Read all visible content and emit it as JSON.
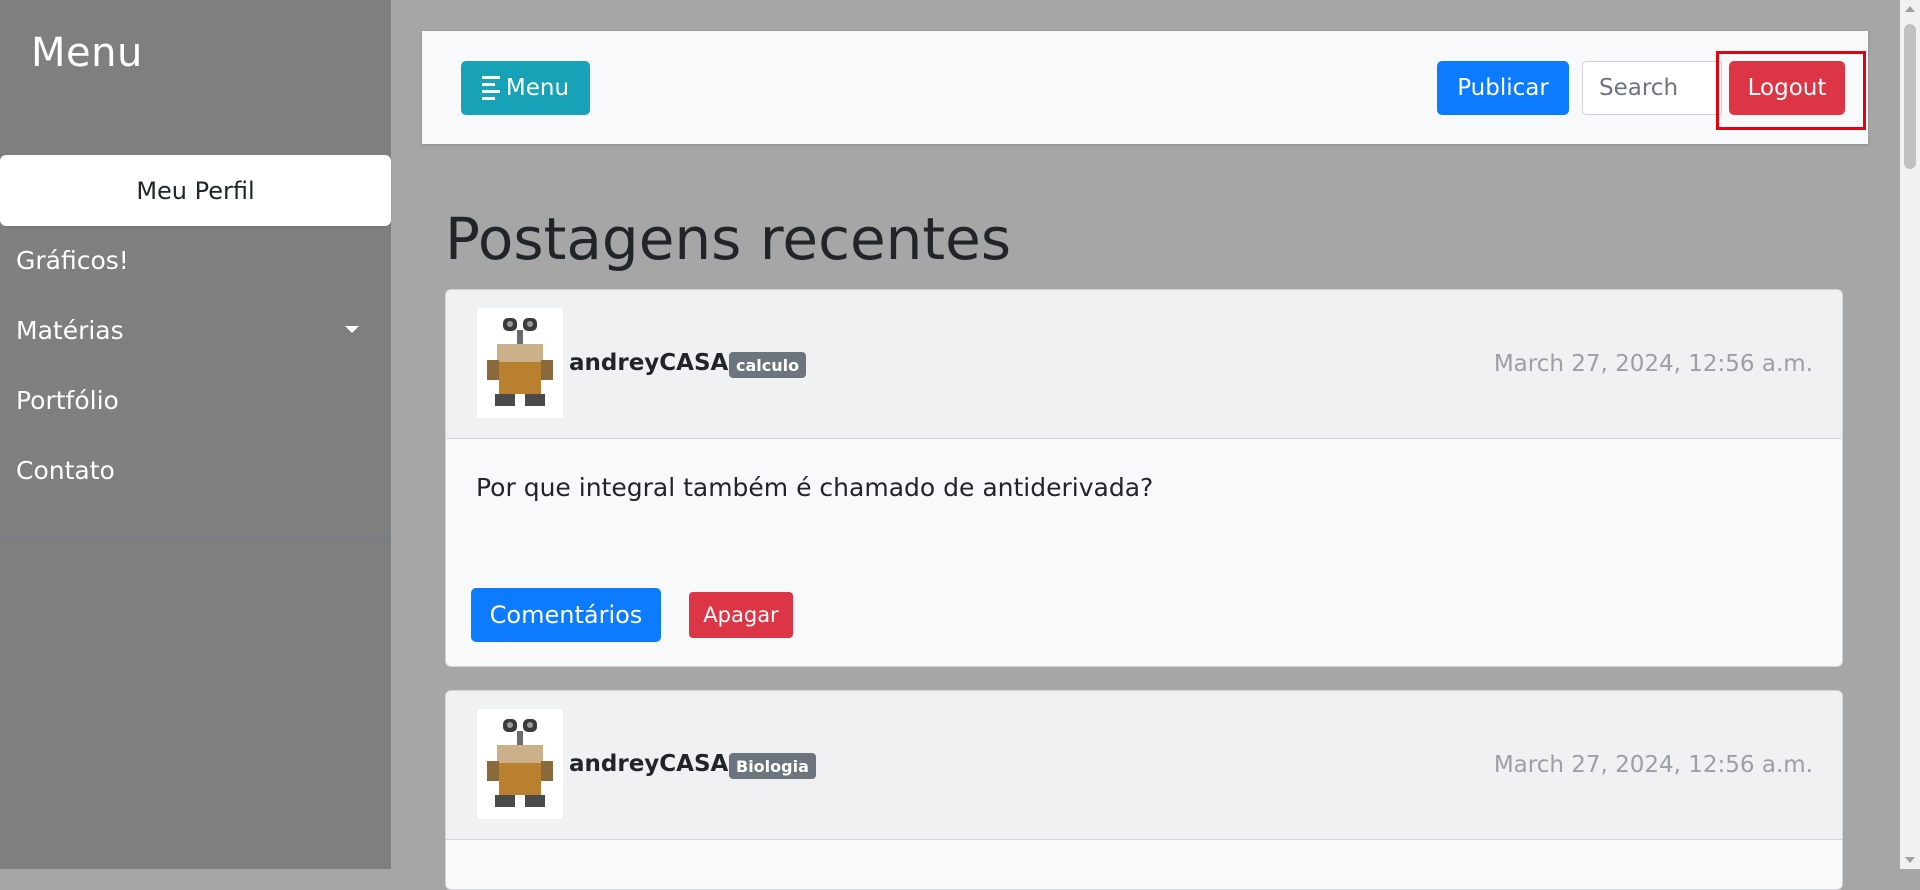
{
  "sidebar": {
    "title": "Menu",
    "active_item": "Meu Perfil",
    "items": [
      {
        "label": "Gráficos!"
      },
      {
        "label": "Matérias",
        "icon": "caret-down-icon"
      },
      {
        "label": "Portfólio"
      },
      {
        "label": "Contato"
      }
    ]
  },
  "navbar": {
    "menu_button": "Menu",
    "menu_icon": "hamburger-align-left-icon",
    "publish_button": "Publicar",
    "search_placeholder": "Search",
    "logout_button": "Logout"
  },
  "main": {
    "heading": "Postagens recentes",
    "posts": [
      {
        "author": "andreyCASA",
        "tag": "calculo",
        "date": "March 27, 2024, 12:56 a.m.",
        "content": "Por que integral também é chamado de antiderivada?",
        "comments_button": "Comentários",
        "delete_button": "Apagar"
      },
      {
        "author": "andreyCASA",
        "tag": "Biologia",
        "date": "March 27, 2024, 12:56 a.m."
      }
    ]
  },
  "colors": {
    "sidebar_bg": "#7f7f7f",
    "page_bg": "#a6a6a6",
    "primary": "#0d7bff",
    "info": "#17a2b8",
    "danger": "#dc3545",
    "badge": "#6c757d",
    "highlight_box": "#e3000f"
  }
}
